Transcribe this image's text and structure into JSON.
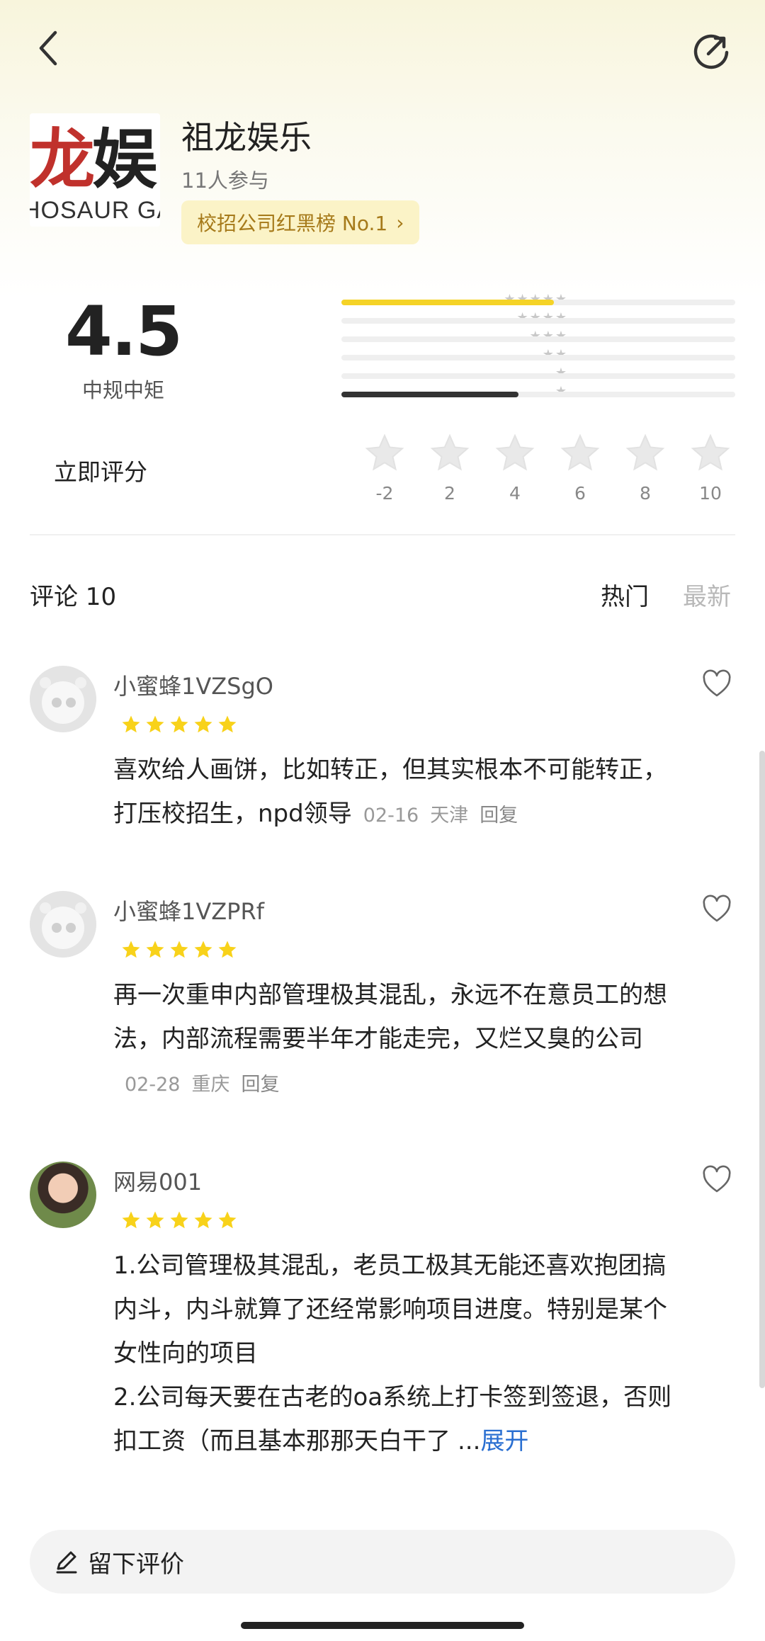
{
  "header": {
    "back_icon": "chevron-left-icon",
    "share_icon": "share-arrow-icon"
  },
  "company": {
    "logo_text_red": "龙",
    "logo_text_black": "娱",
    "logo_subtext": "HOSAUR GA",
    "name": "祖龙娱乐",
    "participants": "11人参与",
    "rank_badge": "校招公司红黑榜 No.1",
    "rank_chevron": "›"
  },
  "rating": {
    "score": "4.5",
    "score_label": "中规中矩",
    "distribution": [
      {
        "stars": 5,
        "fraction": 0.54,
        "color": "#f5d327"
      },
      {
        "stars": 4,
        "fraction": 0.0,
        "color": "#f5d327"
      },
      {
        "stars": 3,
        "fraction": 0.0,
        "color": "#f5d327"
      },
      {
        "stars": 2,
        "fraction": 0.0,
        "color": "#f5d327"
      },
      {
        "stars": 1,
        "fraction": 0.0,
        "color": "#f5d327"
      },
      {
        "stars": 0,
        "fraction": 0.45,
        "color": "#333333"
      }
    ],
    "rate_now_label": "立即评分",
    "rate_options": [
      "-2",
      "2",
      "4",
      "6",
      "8",
      "10"
    ]
  },
  "comments_header": {
    "title": "评论 10",
    "tab_hot": "热门",
    "tab_new": "最新"
  },
  "comments": [
    {
      "username": "小蜜蜂1VZSgO",
      "stars": 5,
      "text": "喜欢给人画饼，比如转正，但其实根本不可能转正，打压校招生，npd领导",
      "date": "02-16",
      "location": "天津",
      "reply": "回复"
    },
    {
      "username": "小蜜蜂1VZPRf",
      "stars": 5,
      "text": "再一次重申内部管理极其混乱，永远不在意员工的想法，内部流程需要半年才能走完，又烂又臭的公司",
      "date": "02-28",
      "location": "重庆",
      "reply": "回复"
    },
    {
      "username": "网易001",
      "stars": 5,
      "line1": "1.公司管理极其混乱，老员工极其无能还喜欢抱团搞内斗，内斗就算了还经常影响项目进度。特别是某个女性向的项目",
      "line2": "2.公司每天要在古老的oa系统上打卡签到签退，否则扣工资（而且基本那那天白干了",
      "ellipsis": "...",
      "expand": "展开"
    }
  ],
  "bottom": {
    "leave_review": "留下评价",
    "pen_icon": "edit-pen-icon"
  }
}
